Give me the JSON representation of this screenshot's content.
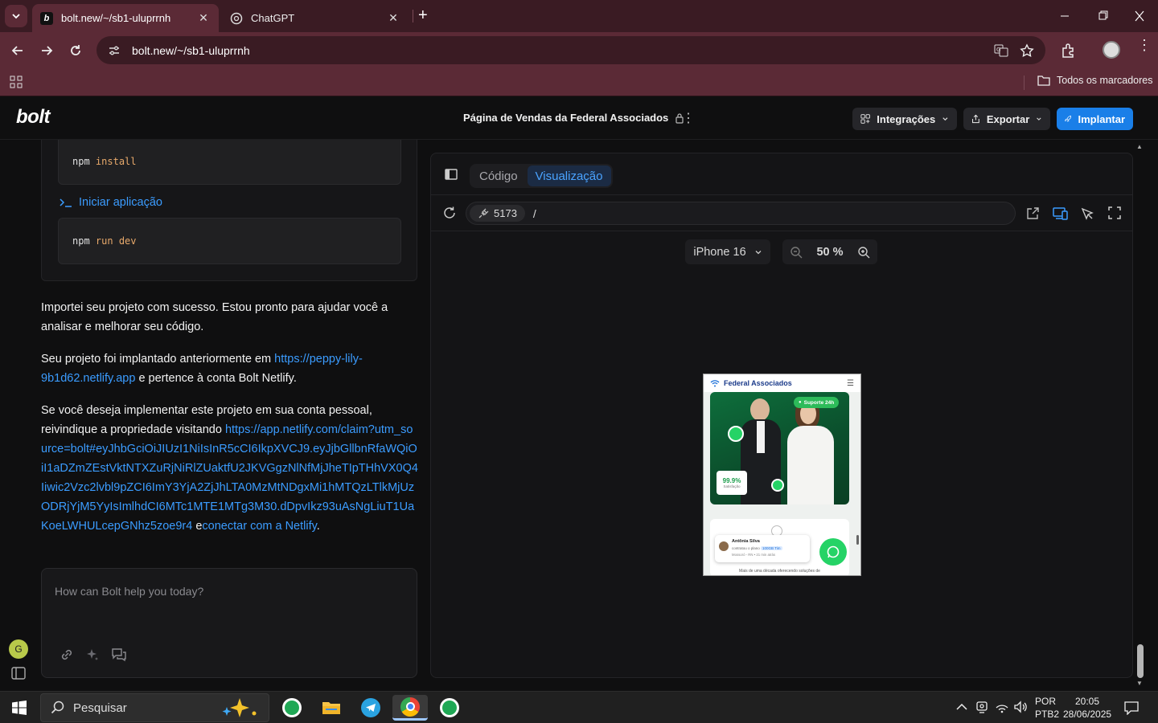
{
  "browser": {
    "tabs": [
      {
        "title": "bolt.new/~/sb1-uluprrnh",
        "active": true
      },
      {
        "title": "ChatGPT",
        "active": false
      }
    ],
    "url": "bolt.new/~/sb1-uluprrnh",
    "bookmarks_label": "Todos os marcadores"
  },
  "bolt": {
    "logo": "bolt",
    "project_title": "Página de Vendas da Federal Associados",
    "buttons": {
      "integrations": "Integrações",
      "export": "Exportar",
      "deploy": "Implantar"
    }
  },
  "chat": {
    "cmd_install": {
      "a": "npm",
      "b": "install"
    },
    "start_label": "Iniciar aplicação",
    "cmd_run": {
      "a": "npm",
      "b": "run dev"
    },
    "msg1": "Importei seu projeto com sucesso. Estou pronto para ajudar você a analisar e melhorar seu código.",
    "msg2_prefix": "Seu projeto foi implantado anteriormente em ",
    "msg2_link": "https://peppy-lily-9b1d62.netlify.app",
    "msg2_suffix": " e pertence à conta Bolt Netlify.",
    "msg3_prefix": "Se você deseja implementar este projeto em sua conta pessoal, reivindique a propriedade visitando ",
    "msg3_link": "https://app.netlify.com/claim?utm_source=bolt#eyJhbGciOiJIUzI1NiIsInR5cCI6IkpXVCJ9.eyJjbGllbnRfaWQiOiI1aDZmZEstVktNTXZuRjNiRlZUaktfU2JKVGgzNlNfMjJheTIpTHhVX0Q4Iiwic2Vzc2lvbl9pZCI6ImY3YjA2ZjJhLTA0MzMtNDgxMi1hMTQzLTlkMjUzODRjYjM5YyIsImlhdCI6MTc1MTE1MTg3M30.dDpvIkz93uAsNgLiuT1UaKoeLWHULcepGNhz5zoe9r4",
    "msg3_mid": " e",
    "msg3_link2": "conectar com a Netlify",
    "msg3_end": ".",
    "input_placeholder": "How can Bolt help you today?",
    "user_initial": "G"
  },
  "preview": {
    "tab_code": "Código",
    "tab_preview": "Visualização",
    "port": "5173",
    "path": "/",
    "device": "iPhone 16",
    "zoom": "50 %",
    "mini": {
      "brand": "Federal Associados",
      "support_badge": "Suporte 24h",
      "stat_value": "99.9%",
      "stat_label": "Satisfação",
      "testimonial_name": "Antônia Silva",
      "testimonial_line1": "contratou o plano",
      "testimonial_plan": "100GB Tim",
      "testimonial_line2": "Mossoró - RN • 21 min atrás",
      "footer_text": "Mais de uma década oferecendo soluções de"
    }
  },
  "taskbar": {
    "search_placeholder": "Pesquisar",
    "lang1": "POR",
    "lang2": "PTB2",
    "time": "20:05",
    "date": "28/06/2025"
  }
}
